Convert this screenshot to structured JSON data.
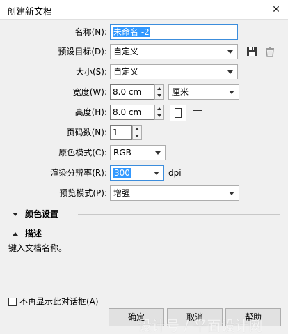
{
  "window": {
    "title": "创建新文档"
  },
  "form": {
    "name": {
      "label": "名称(N):",
      "value": "未命名 -2"
    },
    "preset": {
      "label": "预设目标(D):",
      "value": "自定义"
    },
    "size": {
      "label": "大小(S):",
      "value": "自定义"
    },
    "width": {
      "label": "宽度(W):",
      "value": "8.0 cm",
      "unit": "厘米"
    },
    "height": {
      "label": "高度(H):",
      "value": "8.0 cm"
    },
    "pages": {
      "label": "页码数(N):",
      "value": "1"
    },
    "color_mode": {
      "label": "原色模式(C):",
      "value": "RGB"
    },
    "resolution": {
      "label": "渲染分辨率(R):",
      "value": "300",
      "unit": "dpi"
    },
    "preview": {
      "label": "预览模式(P):",
      "value": "增强"
    }
  },
  "sections": {
    "color_settings": "颜色设置",
    "description": "描述",
    "description_text": "键入文档名称。"
  },
  "footer": {
    "dont_show": "不再显示此对话框(A)",
    "dont_show_checked": false,
    "ok": "确定",
    "cancel": "取消",
    "help": "帮助"
  },
  "watermark": "设计号 / 平面设计网",
  "icons": [
    "close-icon",
    "save-preset-icon",
    "delete-preset-icon",
    "portrait-icon",
    "landscape-icon",
    "dropdown-arrow-icon",
    "spin-up-icon",
    "spin-down-icon"
  ]
}
